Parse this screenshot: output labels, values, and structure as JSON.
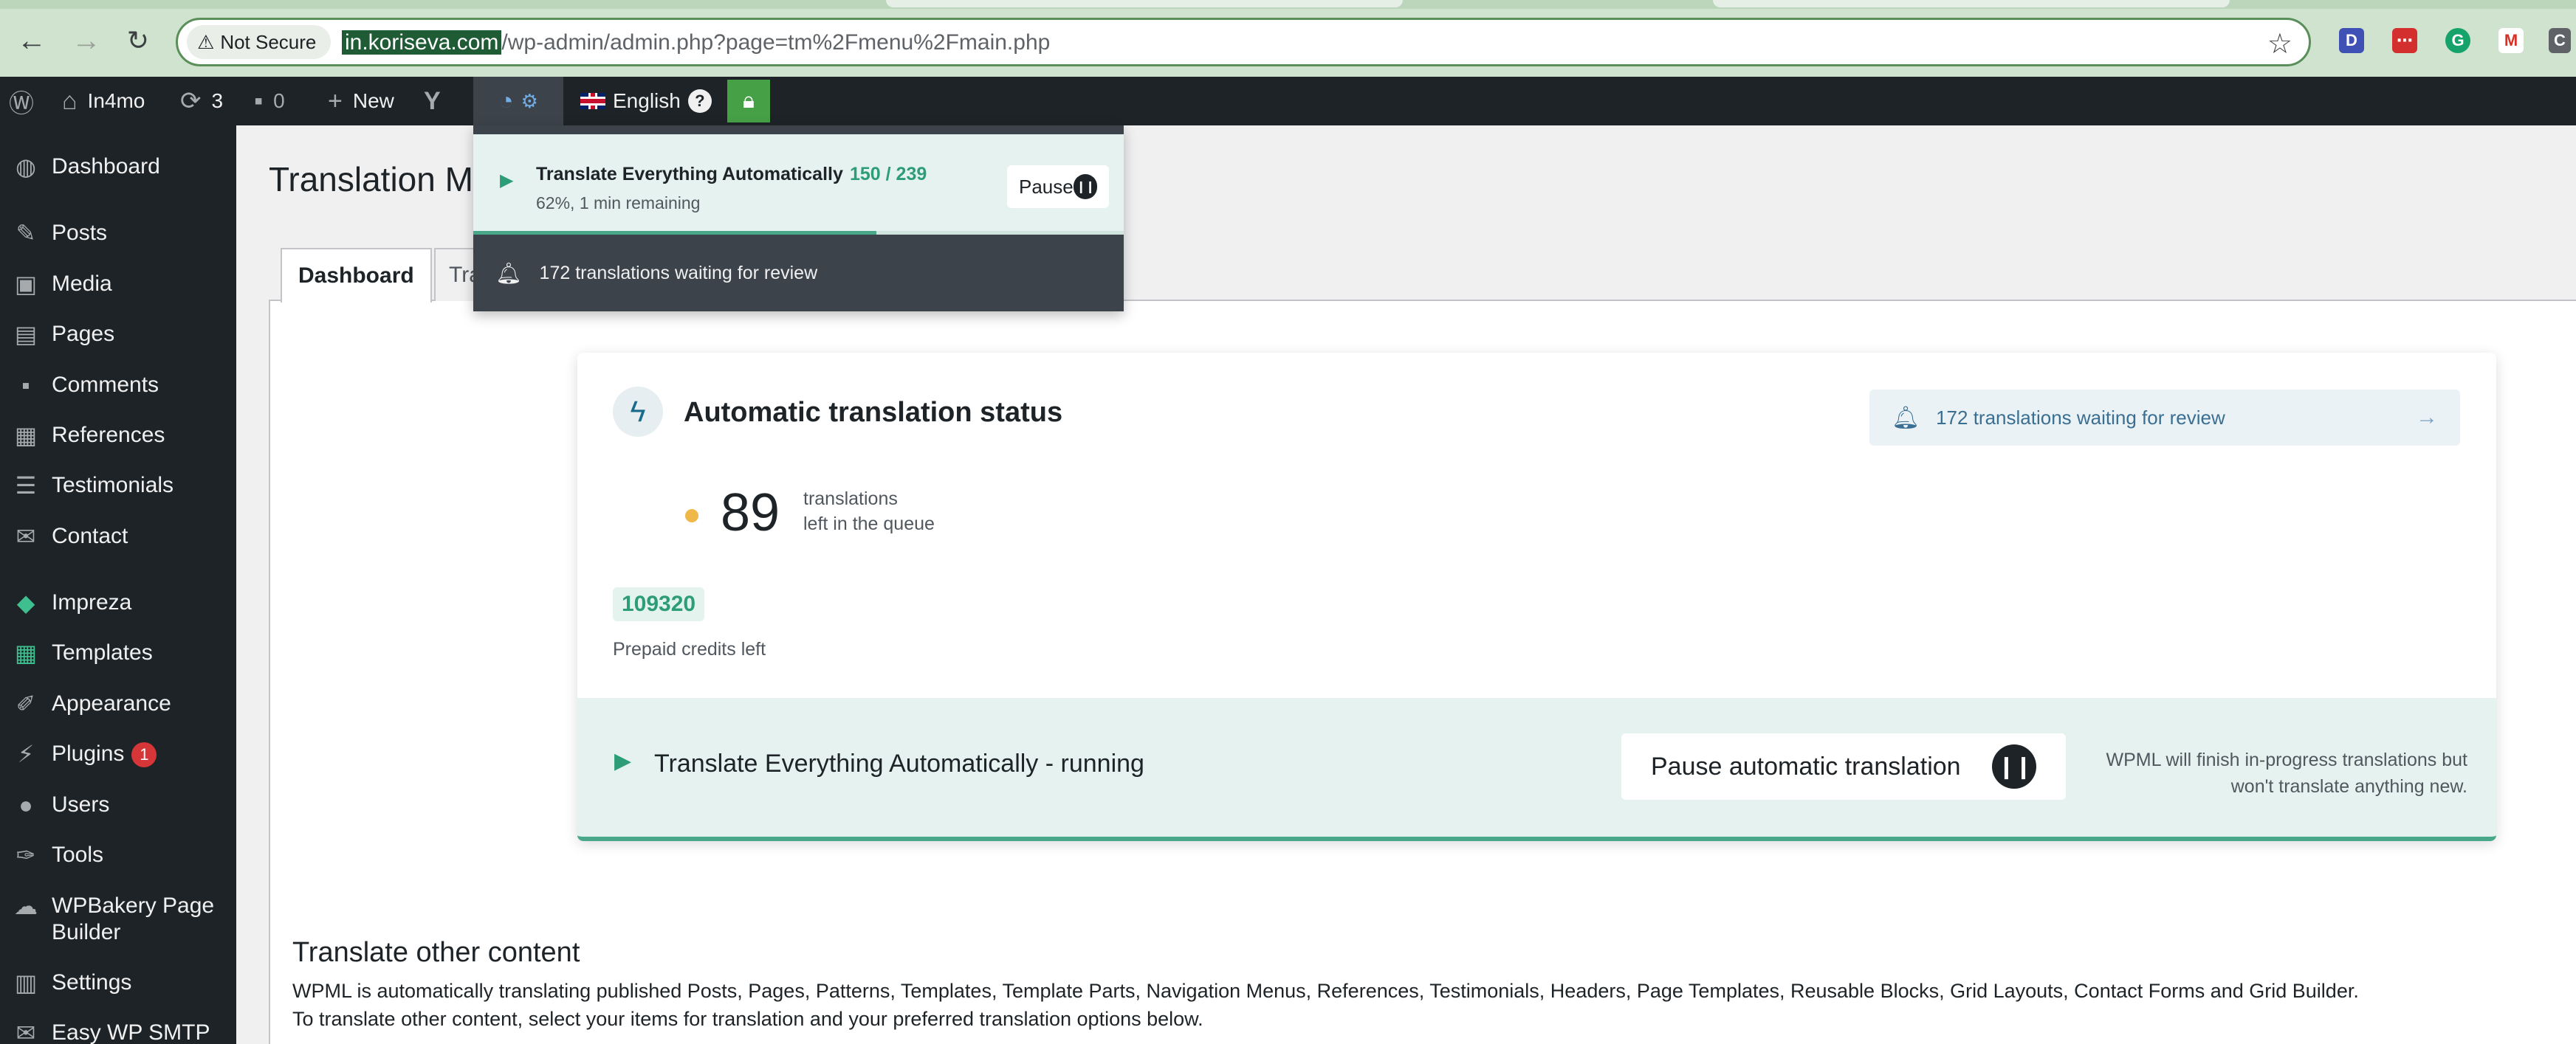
{
  "browser": {
    "not_secure_label": "Not Secure",
    "url_host": "in.koriseva.com",
    "url_path": "/wp-admin/admin.php?page=tm%2Fmenu%2Fmain.php"
  },
  "adminbar": {
    "site_name": "In4mo",
    "updates_count": "3",
    "comments_count": "0",
    "new_label": "New",
    "language_label": "English",
    "help_label": "?"
  },
  "sidebar": {
    "items": [
      {
        "label": "Dashboard",
        "icon": "dashboard-icon"
      },
      {
        "label": "Posts",
        "icon": "pin-icon"
      },
      {
        "label": "Media",
        "icon": "media-icon"
      },
      {
        "label": "Pages",
        "icon": "pages-icon"
      },
      {
        "label": "Comments",
        "icon": "comment-icon"
      },
      {
        "label": "References",
        "icon": "references-icon"
      },
      {
        "label": "Testimonials",
        "icon": "testimonials-icon"
      },
      {
        "label": "Contact",
        "icon": "mail-icon"
      },
      {
        "label": "Impreza",
        "icon": "diamond-icon"
      },
      {
        "label": "Templates",
        "icon": "templates-icon"
      },
      {
        "label": "Appearance",
        "icon": "brush-icon"
      },
      {
        "label": "Plugins",
        "icon": "plugin-icon",
        "badge": "1"
      },
      {
        "label": "Users",
        "icon": "user-icon"
      },
      {
        "label": "Tools",
        "icon": "wrench-icon"
      },
      {
        "label": "WPBakery Page Builder",
        "icon": "cloud-icon"
      },
      {
        "label": "Settings",
        "icon": "settings-icon"
      },
      {
        "label": "Easy WP SMTP",
        "icon": "smtp-icon"
      }
    ]
  },
  "main": {
    "page_title": "Translation Ma",
    "tabs": [
      {
        "label": "Dashboard"
      },
      {
        "label": "Tra"
      }
    ]
  },
  "status_card": {
    "title": "Automatic translation status",
    "review_text": "172 translations waiting for review",
    "queue_count": "89",
    "queue_line1": "translations",
    "queue_line2": "left in the queue",
    "credits_value": "109320",
    "credits_label": "Prepaid credits left",
    "running_label": "Translate Everything Automatically - running",
    "pause_button_label": "Pause automatic translation",
    "pause_note_line1": "WPML will finish in-progress translations but",
    "pause_note_line2": "won't translate anything new."
  },
  "other_content": {
    "title": "Translate other content",
    "line1": "WPML is automatically translating published Posts, Pages, Patterns, Templates, Template Parts, Navigation Menus, References, Testimonials, Headers, Page Templates, Reusable Blocks, Grid Layouts, Contact Forms and Grid Builder.",
    "line2": "To translate other content, select your items for translation and your preferred translation options below."
  },
  "dropdown": {
    "title": "Translate Everything Automatically",
    "count": "150 / 239",
    "progress": 0.62,
    "subtitle": "62%, 1 min remaining",
    "pause_label": "Pause",
    "review_text": "172 translations waiting for review"
  },
  "colors": {
    "admin_dark": "#1d2327",
    "wpml_green": "#2d9d78",
    "band_bg": "#e6f2ef",
    "review_blue": "#3a6f92",
    "queue_dot": "#f0b849"
  }
}
